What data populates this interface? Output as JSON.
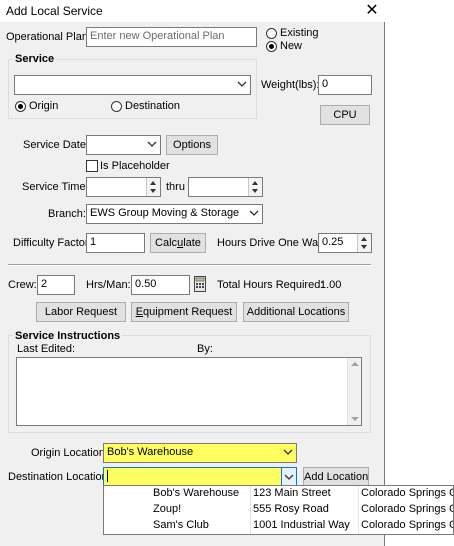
{
  "window": {
    "title": "Add Local Service",
    "close_glyph": "✕"
  },
  "plan": {
    "label": "Operational Plan:",
    "placeholder": "Enter new Operational Plan",
    "existing_label": "Existing",
    "new_label": "New",
    "selected": "New"
  },
  "service": {
    "group_title": "Service",
    "value": "",
    "origin_label": "Origin",
    "destination_label": "Destination",
    "selected": "Origin"
  },
  "weight": {
    "label": "Weight(lbs):",
    "value": "0"
  },
  "cpu_button": "CPU",
  "service_date": {
    "label": "Service Date:",
    "value": "",
    "options_button": "Options"
  },
  "placeholder_checkbox": {
    "label": "Is Placeholder",
    "checked": false
  },
  "service_time": {
    "label": "Service Time:",
    "from": "",
    "thru_label": "thru",
    "to": ""
  },
  "branch": {
    "label": "Branch:",
    "value": "EWS Group Moving & Storage"
  },
  "difficulty": {
    "label": "Difficulty Factor:",
    "value": "1",
    "calculate_button_pre": "Calc",
    "calculate_button_key": "u",
    "calculate_button_post": "late"
  },
  "hours_drive": {
    "label": "Hours Drive One Way:",
    "value": "0.25"
  },
  "crew": {
    "label": "Crew:",
    "value": "2"
  },
  "hrs_man": {
    "label": "Hrs/Man:",
    "value": "0.50"
  },
  "total_hours": {
    "label": "Total Hours Required:",
    "value": "1.00"
  },
  "buttons": {
    "labor_request": "Labor Request",
    "equipment_request_key": "E",
    "equipment_request_rest": "quipment Request",
    "additional_locations": "Additional Locations"
  },
  "instructions": {
    "group_title": "Service Instructions",
    "last_edited_label": "Last Edited:",
    "last_edited_value": "",
    "by_label": "By:",
    "by_value": "",
    "text": ""
  },
  "origin_location": {
    "label": "Origin Location:",
    "value": "Bob's Warehouse"
  },
  "destination_location": {
    "label": "Destination Location:",
    "value": "",
    "add_button": "Add Location"
  },
  "location_dropdown": [
    {
      "name": "Bob's Warehouse",
      "address": "123 Main Street",
      "city": "Colorado Springs CO"
    },
    {
      "name": "Zoup!",
      "address": "555 Rosy Road",
      "city": "Colorado Springs CO"
    },
    {
      "name": "Sam's Club",
      "address": "1001 Industrial Way",
      "city": "Colorado Springs CO"
    }
  ],
  "colors": {
    "highlight": "#ffff60",
    "dialog_bg": "#f0f0f0",
    "focus_border": "#0078d7"
  }
}
